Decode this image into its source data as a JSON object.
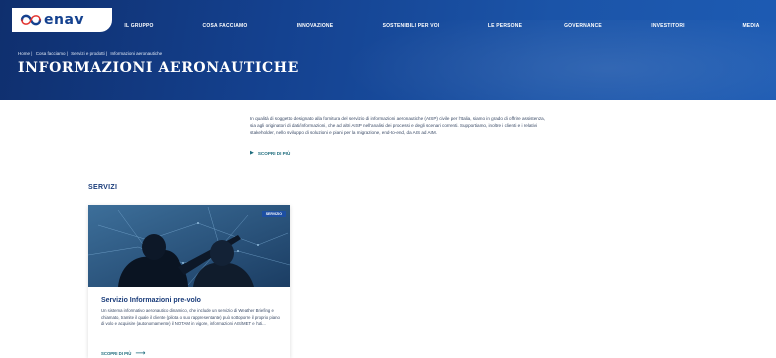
{
  "header": {
    "logo_text": "enav",
    "nav": [
      {
        "label": "IL GRUPPO"
      },
      {
        "label": "COSA FACCIAMO"
      },
      {
        "label": "INNOVAZIONE"
      },
      {
        "label": "SOSTENIBILI PER VOI"
      },
      {
        "label": "LE PERSONE"
      },
      {
        "label": "GOVERNANCE"
      },
      {
        "label": "INVESTITORI"
      },
      {
        "label": "MEDIA"
      }
    ]
  },
  "breadcrumb": {
    "home": "Home |",
    "cosa": "Cosa facciamo |",
    "servizi": "Servizi e prodotti |",
    "current": "Informazioni aeronautiche"
  },
  "page_title": "INFORMAZIONI AERONAUTICHE",
  "intro": {
    "text": "In qualità di soggetto designato alla fornitura del servizio di informazioni aeronautiche (AISP) civile per l'Italia, siamo in grado di offrire assistenza, sia agli originatori di dati/informazioni, che ad altri AISP nell'analisi dei processi e degli scenari correnti. Supportiamo, inoltre i clienti e i relativi stakeholder, nello sviluppo di soluzioni e piani per la migrazione, end-to-end, da AIS ad AIM.",
    "more_label": "SCOPRI DI PIÙ"
  },
  "services": {
    "title": "SERVIZI",
    "cards": [
      {
        "tag": "SERVIZIO",
        "title": "Servizio Informazioni pre-volo",
        "text": "Un sistema informativo aeronautico dinamico, che include un servizio di Weather Briefing e chiamato, tramite il quale il cliente (pilota o suo rappresentante) può sottoporre il proprio piano di volo e acquisire (autonomamente) il NOTAM in vigore, informazioni AIS/MET e l'uti...",
        "link_label": "SCOPRI DI PIÙ"
      }
    ]
  },
  "colors": {
    "brand_blue": "#14418f",
    "link_teal": "#1d6b7c",
    "title_navy": "#1a3c7a"
  }
}
